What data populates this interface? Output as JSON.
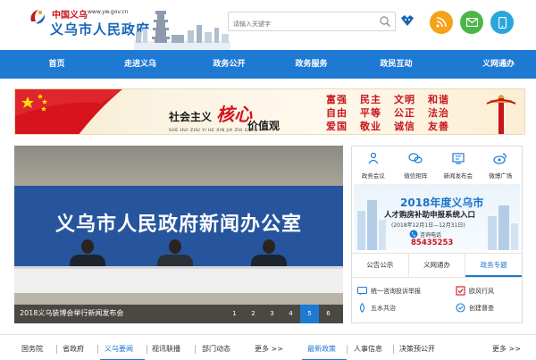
{
  "header": {
    "site_name_small": "中国义乌",
    "site_url": "www.yw.gov.cn",
    "site_name": "义乌市人民政府",
    "search_placeholder": "请输入关键字"
  },
  "nav": {
    "items": [
      "首页",
      "走进义乌",
      "政务公开",
      "政务服务",
      "政民互动",
      "义网通办"
    ]
  },
  "banner": {
    "prefix": "社会主义",
    "emphasis": "核心",
    "suffix": "价值观",
    "pinyin": "SHE HUI ZHU YI HE XIN JIA ZHI GUAN",
    "values": [
      "富强",
      "民主",
      "文明",
      "和谐",
      "自由",
      "平等",
      "公正",
      "法治",
      "爱国",
      "敬业",
      "诚信",
      "友善"
    ]
  },
  "slide": {
    "headline": "义乌市人民政府新闻办公室",
    "caption": "2018义乌装博会举行新闻发布会",
    "pages": [
      "1",
      "2",
      "3",
      "4",
      "5",
      "6"
    ],
    "active_page": "5"
  },
  "quick_links": [
    {
      "label": "政务会议",
      "icon": "meeting-icon"
    },
    {
      "label": "微信矩阵",
      "icon": "wechat-icon"
    },
    {
      "label": "新闻发布会",
      "icon": "press-conference-icon"
    },
    {
      "label": "微博广场",
      "icon": "weibo-icon"
    }
  ],
  "promo": {
    "title": "2018年度义乌市",
    "subtitle": "人才购房补助申报系统入口",
    "date": "(2018年12月1日—12月31日)",
    "phone_label": "咨询电话",
    "phone": "85435253"
  },
  "tabs": {
    "items": [
      "公告公示",
      "义网通办",
      "政务专题"
    ],
    "active": "政务专题"
  },
  "services": [
    {
      "label": "统一咨询投诉举报",
      "icon": "complaint-icon"
    },
    {
      "label": "欧风行风",
      "icon": "conduct-icon"
    },
    {
      "label": "五水共治",
      "icon": "water-icon"
    },
    {
      "label": "创建督查",
      "icon": "inspection-icon"
    }
  ],
  "bottom_links": {
    "group1": [
      "国务院",
      "省政府",
      "义乌要闻",
      "视讯联播",
      "部门动态"
    ],
    "more1": "更多 >>",
    "group2": [
      "最新政策",
      "人事信息",
      "决策预公开"
    ],
    "more2": "更多 >>"
  },
  "colors": {
    "primary_blue": "#1e79d2",
    "brand_red": "#c8161d",
    "rss_orange": "#f5a21b",
    "mail_green": "#4cb749",
    "mobile_cyan": "#28a7dc"
  }
}
